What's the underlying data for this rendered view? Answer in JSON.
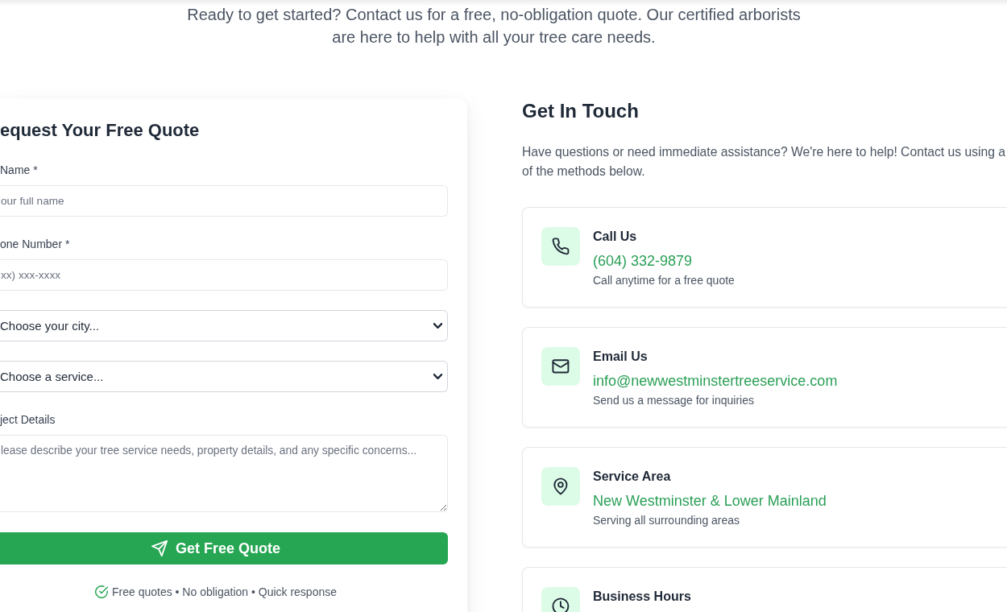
{
  "intro": "Ready to get started? Contact us for a free, no-obligation quote. Our certified arborists are here to help with all your tree care needs.",
  "quote_form": {
    "title": "equest Your Free Quote",
    "fields": [
      {
        "kind": "text",
        "label": "Name *",
        "placeholder": "our full name"
      },
      {
        "kind": "text",
        "label": "one Number *",
        "placeholder": "xx) xxx-xxxx"
      },
      {
        "kind": "select",
        "value": "Choose your city..."
      },
      {
        "kind": "select",
        "value": "Choose a service..."
      },
      {
        "kind": "textarea",
        "label": "ject Details",
        "placeholder": "lease describe your tree service needs, property details, and any specific concerns..."
      }
    ],
    "submit_button": "Get Free Quote",
    "note": "Free quotes • No obligation • Quick response"
  },
  "contact": {
    "title": "Get In Touch",
    "description": "Have questions or need immediate assistance? We're here to help! Contact us using a of the methods below.",
    "methods": [
      {
        "kind": "phone",
        "title": "Call Us",
        "value": "(604) 332-9879",
        "note": "Call anytime for a free quote"
      },
      {
        "kind": "email",
        "title": "Email Us",
        "value": "info@newwestminstertreeservice.com",
        "note": "Send us a message for inquiries"
      },
      {
        "kind": "area",
        "title": "Service Area",
        "value": "New Westminster & Lower Mainland",
        "note": "Serving all surrounding areas"
      },
      {
        "kind": "hours",
        "title": "Business Hours"
      }
    ]
  }
}
